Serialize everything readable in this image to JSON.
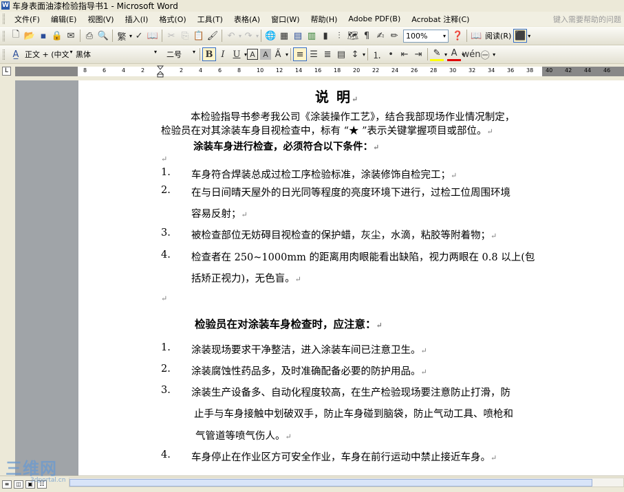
{
  "window": {
    "title": "车身表面油漆检验指导书1 - Microsoft Word",
    "icon": "W"
  },
  "menu": {
    "items": [
      "文件(F)",
      "编辑(E)",
      "视图(V)",
      "插入(I)",
      "格式(O)",
      "工具(T)",
      "表格(A)",
      "窗口(W)",
      "帮助(H)",
      "Adobe PDF(B)",
      "Acrobat 注释(C)"
    ],
    "help_placeholder": "键入需要帮助的问题"
  },
  "toolbar": {
    "zoom": "100%",
    "read_label": "阅读(R)"
  },
  "format_toolbar": {
    "style": "正文 + (中文",
    "font": "黑体",
    "size": "二号"
  },
  "ruler": {
    "labels": [
      "8",
      "6",
      "4",
      "2",
      "2",
      "4",
      "6",
      "8",
      "10",
      "12",
      "14",
      "16",
      "18",
      "20",
      "22",
      "24",
      "26",
      "28",
      "30",
      "32",
      "34",
      "36",
      "38",
      "40",
      "42",
      "44",
      "46"
    ]
  },
  "document": {
    "title": "说    明",
    "intro": [
      "本检验指导书参考我公司《涂装操作工艺》，结合我部现场作业情况制定，",
      "检验员在对其涂装车身目视检查中，标有 “★ ”表示关键掌握项目或部位。"
    ],
    "section1_title": "涂装车身进行检查，必须符合以下条件：",
    "section1_items": [
      {
        "num": "1.",
        "lines": [
          "车身符合焊装总成过检工序检验标准，涂装修饰自检完工；"
        ]
      },
      {
        "num": "2.",
        "lines": [
          "在与日间晴天屋外的日光同等程度的亮度环境下进行，过检工位周围环境",
          "容易反射；"
        ]
      },
      {
        "num": "3.",
        "lines": [
          "被检查部位无妨碍目视检查的保护蜡，灰尘，水滴，粘胶等附着物；"
        ]
      },
      {
        "num": "4.",
        "lines": [
          "检查者在 250~1000mm 的距离用肉眼能看出缺陷，视力两眼在 0.8 以上(包",
          "括矫正视力)，无色盲。"
        ]
      }
    ],
    "section2_title": "检验员在对涂装车身检查时，应注意：",
    "section2_items": [
      {
        "num": "1.",
        "lines": [
          "涂装现场要求干净整洁，进入涂装车间已注意卫生。"
        ]
      },
      {
        "num": "2.",
        "lines": [
          "涂装腐蚀性药品多，及时准确配备必要的防护用品。"
        ]
      },
      {
        "num": "3.",
        "lines": [
          "涂装生产设备多、自动化程度较高，在生产检验现场要注意防止打滑，防",
          "止手与车身接触中划破双手，防止车身碰到脑袋，防止气动工具、喷枪和",
          "气管道等喷气伤人。"
        ]
      },
      {
        "num": "4.",
        "lines": [
          "车身停止在作业区方可安全作业，车身在前行运动中禁止接近车身。"
        ]
      }
    ],
    "paragraph_mark": "↵"
  },
  "watermark": {
    "main": "三维网",
    "sub": "3dportal.cn"
  }
}
